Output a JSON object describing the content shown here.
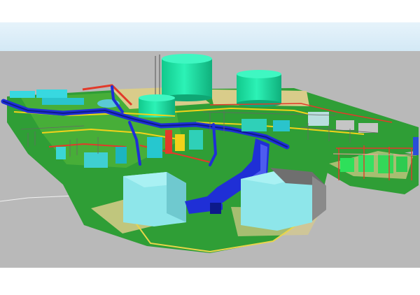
{
  "scene": {
    "kind": "3D plant model render",
    "colors": {
      "sky_top": "#e6f3fb",
      "sky_bottom": "#d2e8f5",
      "ground": "#b9b9b9",
      "grass": "#2f9e36",
      "grass_light": "#66c23c",
      "concrete": "#d9cc8a",
      "tank": "#22e6a8",
      "tank_dark": "#14b985",
      "pipe_blue": "#1f2fd6",
      "pipe_dark": "#0d1a8a",
      "building": "#8ee6ea",
      "building_side": "#6fc9cf",
      "roof_dark": "#6f6f6f",
      "red": "#e23a2a",
      "yellow": "#f2d21a",
      "cyan": "#38d8e0"
    }
  }
}
